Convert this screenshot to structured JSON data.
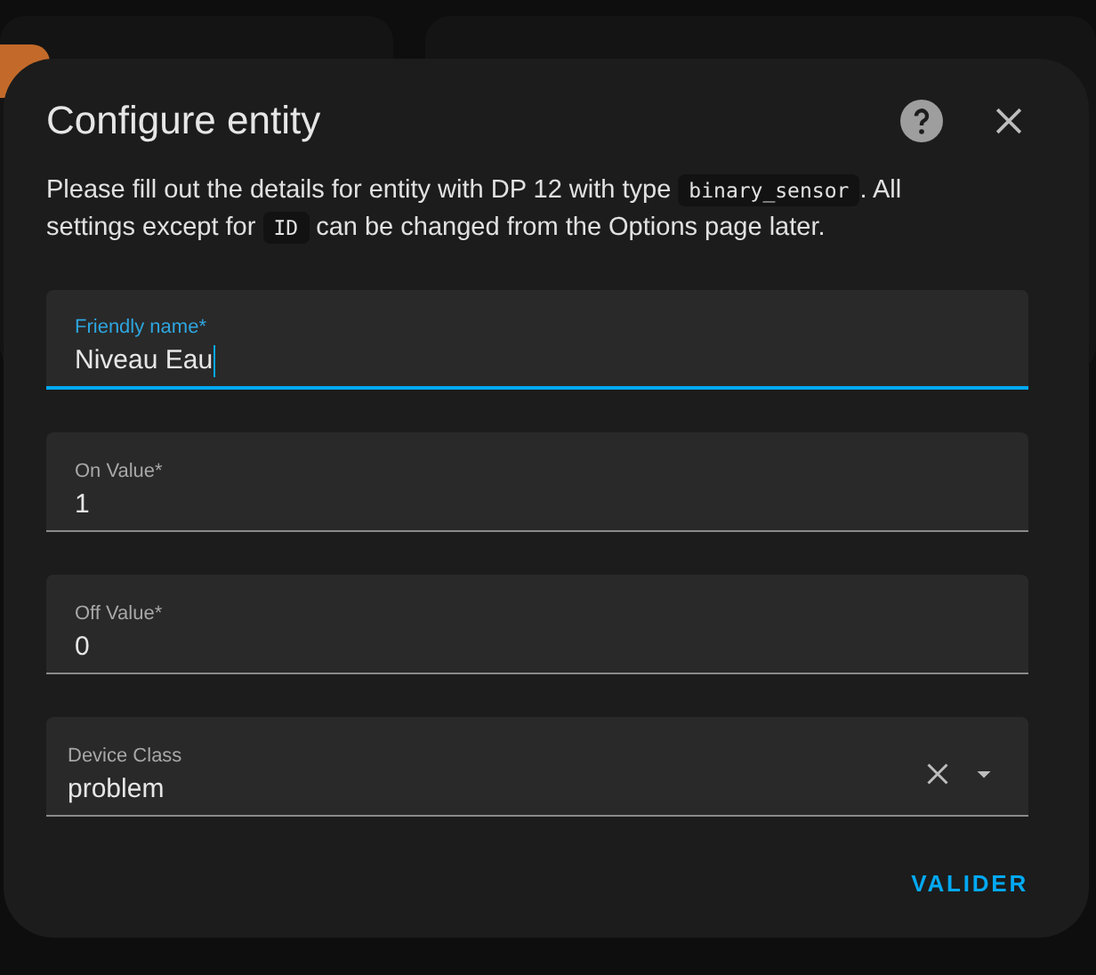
{
  "dialog": {
    "title": "Configure entity",
    "description": [
      {
        "kind": "text",
        "text": "Please fill out the details for entity with DP 12 with type "
      },
      {
        "kind": "code",
        "text": "binary_sensor"
      },
      {
        "kind": "text",
        "text": ". All settings except for "
      },
      {
        "kind": "code",
        "text": "ID"
      },
      {
        "kind": "text",
        "text": " can be changed from the Options page later."
      }
    ],
    "fields": [
      {
        "kind": "text",
        "label": "Friendly name*",
        "value": "Niveau Eau",
        "focused": true
      },
      {
        "kind": "text",
        "label": "On Value*",
        "value": "1",
        "focused": false
      },
      {
        "kind": "text",
        "label": "Off Value*",
        "value": "0",
        "focused": false
      },
      {
        "kind": "select",
        "label": "Device Class",
        "value": "problem",
        "focused": false
      }
    ],
    "submit": "VALIDER"
  }
}
